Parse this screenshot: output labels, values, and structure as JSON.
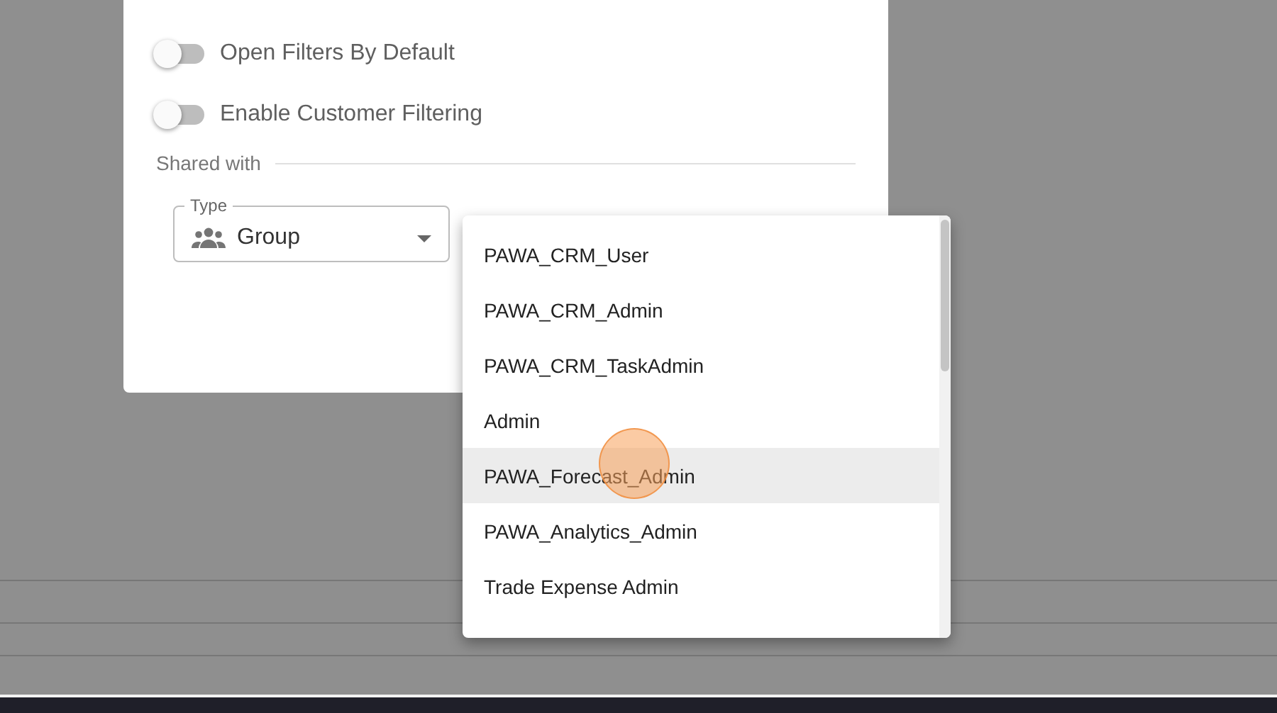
{
  "settings_dialog": {
    "toggles": [
      {
        "label": "Open Filters By Default",
        "on": false
      },
      {
        "label": "Enable Customer Filtering",
        "on": false
      }
    ],
    "shared_with": {
      "label": "Shared with"
    },
    "type_field": {
      "label": "Type",
      "value": "Group"
    }
  },
  "group_menu": {
    "items": [
      {
        "label": "PAWA_CRM_User",
        "selected": false
      },
      {
        "label": "PAWA_CRM_Admin",
        "selected": false
      },
      {
        "label": "PAWA_CRM_TaskAdmin",
        "selected": false
      },
      {
        "label": "Admin",
        "selected": false
      },
      {
        "label": "PAWA_Forecast_Admin",
        "selected": true
      },
      {
        "label": "PAWA_Analytics_Admin",
        "selected": false
      },
      {
        "label": "Trade Expense Admin",
        "selected": false
      }
    ]
  }
}
